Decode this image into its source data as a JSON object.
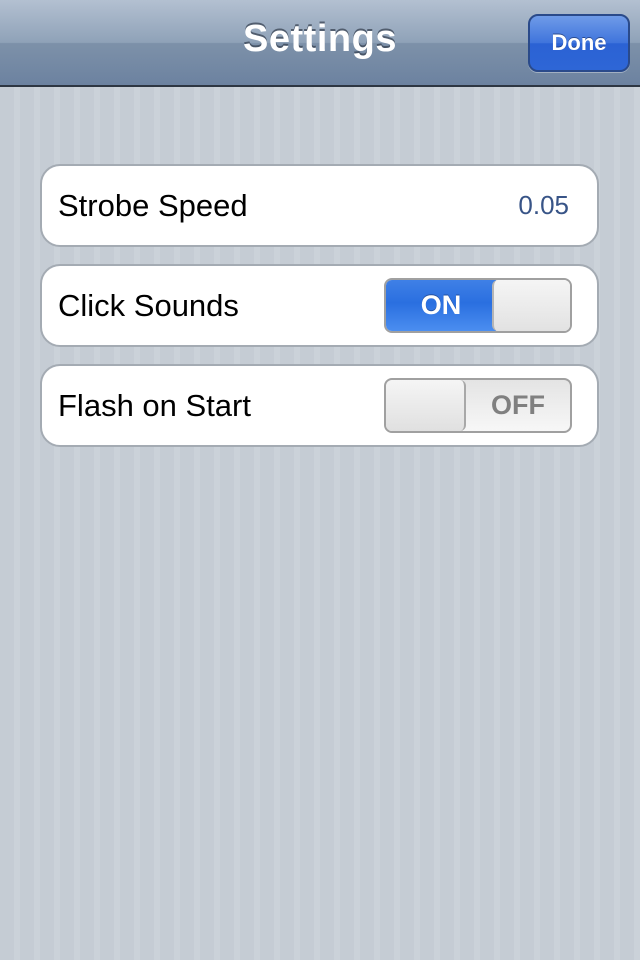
{
  "navbar": {
    "title": "Settings",
    "done_label": "Done"
  },
  "settings": [
    {
      "label": "Strobe Speed",
      "value": "0.05"
    },
    {
      "label": "Click Sounds",
      "switch_state": "ON",
      "on": true
    },
    {
      "label": "Flash on Start",
      "switch_state": "OFF",
      "on": false
    }
  ],
  "colors": {
    "accent": "#2a6fe0",
    "value_text": "#385487",
    "background": "#c5ccd4"
  }
}
